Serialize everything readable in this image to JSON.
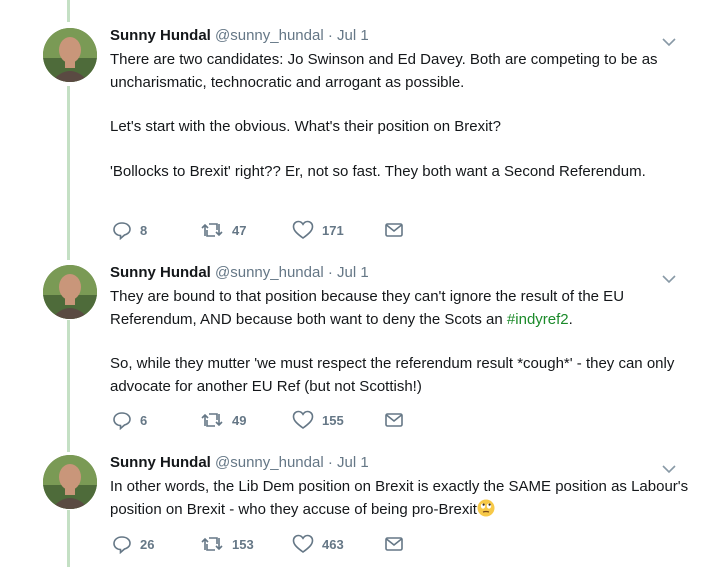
{
  "tweets": [
    {
      "name": "Sunny Hundal",
      "handle": "@sunny_hundal",
      "separator": "·",
      "date": "Jul 1",
      "paragraphs": [
        "There are two candidates: Jo Swinson and Ed Davey. Both are competing to be as uncharismatic, technocratic and arrogant as possible.",
        "Let's start with the obvious. What's their position on Brexit?",
        "'Bollocks to Brexit' right?? Er, not so fast. They both want a Second Referendum."
      ],
      "replies": "8",
      "retweets": "47",
      "likes": "171"
    },
    {
      "name": "Sunny Hundal",
      "handle": "@sunny_hundal",
      "separator": "·",
      "date": "Jul 1",
      "p1_text": "They are bound to that position because they can't ignore the result of the EU Referendum, AND because both want to deny the Scots an ",
      "p1_hashtag": "#indyref2",
      "p1_end": ".",
      "p2": "So, while they mutter 'we must respect the referendum result *cough*' - they can only advocate for another EU Ref (but not Scottish!)",
      "replies": "6",
      "retweets": "49",
      "likes": "155"
    },
    {
      "name": "Sunny Hundal",
      "handle": "@sunny_hundal",
      "separator": "·",
      "date": "Jul 1",
      "p1": "In other words, the Lib Dem position on Brexit is exactly the SAME position as Labour's position on Brexit - who they accuse of being pro-Brexit",
      "emoji": "face-with-rolling-eyes",
      "replies": "26",
      "retweets": "153",
      "likes": "463"
    }
  ],
  "icons": {
    "reply": "reply-icon",
    "retweet": "retweet-icon",
    "like": "heart-icon",
    "message": "envelope-icon",
    "menu": "chevron-down-icon"
  },
  "colors": {
    "thread_line": "#c4e0c4",
    "hashtag": "#1b8a2a",
    "muted": "#657786"
  }
}
